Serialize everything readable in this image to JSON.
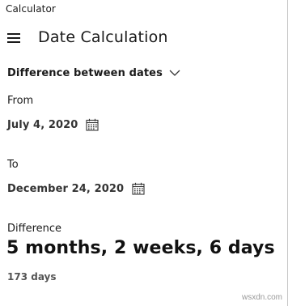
{
  "window": {
    "title": "Calculator"
  },
  "header": {
    "menu_icon": "hamburger-menu-icon",
    "title": "Date Calculation"
  },
  "mode": {
    "selected": "Difference between dates",
    "icon": "chevron-down-icon"
  },
  "from": {
    "label": "From",
    "value": "July 4, 2020",
    "icon": "calendar-icon"
  },
  "to": {
    "label": "To",
    "value": "December 24, 2020",
    "icon": "calendar-icon"
  },
  "difference": {
    "label": "Difference",
    "summary": "5 months, 2 weeks, 6 days",
    "total_days": "173 days"
  },
  "watermark": "wsxdn.com"
}
